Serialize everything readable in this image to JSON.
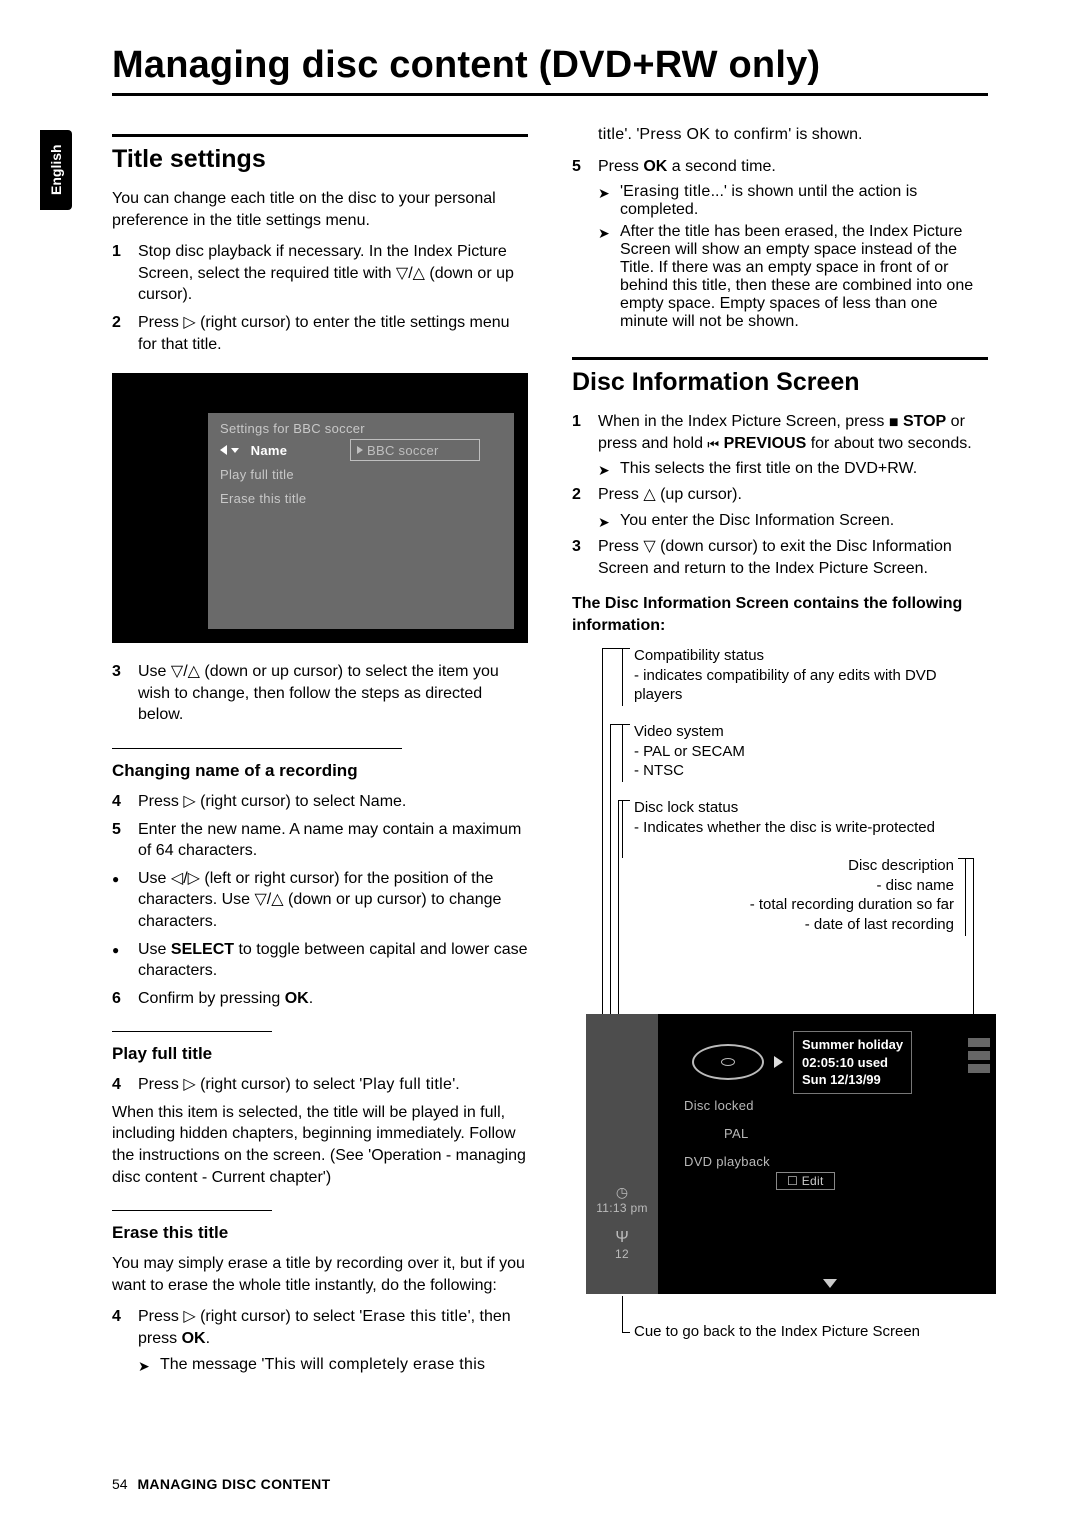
{
  "language_tab": "English",
  "page_title": "Managing disc content (DVD+RW only)",
  "footer": {
    "page_num": "54",
    "section": "MANAGING DISC CONTENT"
  },
  "left": {
    "section_title": "Title settings",
    "intro": "You can change each title on the disc to your personal preference in the title settings menu.",
    "step1": "Stop disc playback if necessary. In the Index Picture Screen, select the required title with ▽/△ (down or up cursor).",
    "step2": "Press ▷ (right cursor) to enter the title settings menu for that title.",
    "step3": "Use ▽/△ (down or up cursor) to select the item you wish to change, then follow the steps as directed below.",
    "shot": {
      "header": "Settings for BBC soccer",
      "row_name": "Name",
      "row_name_value": "BBC soccer",
      "row_play": "Play full title",
      "row_erase": "Erase this title"
    },
    "changing_name_title": "Changing name of a recording",
    "cn_step4": "Press ▷ (right cursor) to select Name.",
    "cn_step5": "Enter the new name. A name may contain a maximum of 64 characters.",
    "cn_bullet1": "Use ◁/▷ (left or right cursor) for the position of the characters. Use ▽/△ (down or up cursor) to change characters.",
    "cn_bullet2_a": "Use ",
    "cn_bullet2_b": "SELECT",
    "cn_bullet2_c": " to toggle between capital and lower case characters.",
    "cn_step6_a": "Confirm by pressing ",
    "cn_step6_b": "OK",
    "cn_step6_c": ".",
    "play_full_title": "Play full title",
    "pft_step4_a": "Press ▷ (right cursor) to select '",
    "pft_step4_b": "Play full title",
    "pft_step4_c": "'.",
    "pft_body": "When this item is selected, the title will be played in full, including hidden chapters, beginning immediately. Follow the instructions on the screen. (See 'Operation - managing disc content - Current chapter')",
    "erase_title": "Erase this title",
    "et_intro": "You may simply erase a title by recording over it, but if you want to erase the whole title instantly, do the following:",
    "et_step4_a": "Press ▷ (right cursor) to select '",
    "et_step4_b": "Erase this title",
    "et_step4_c": "', then press ",
    "et_step4_d": "OK",
    "et_step4_e": ".",
    "et_arrow1_a": "The message '",
    "et_arrow1_b": "This will completely erase this"
  },
  "right": {
    "cont_a": "title",
    "cont_b": "'. '",
    "cont_c": "Press OK to confirm",
    "cont_d": "' is shown.",
    "r_step5_a": "Press ",
    "r_step5_b": "OK",
    "r_step5_c": " a second time.",
    "r_arrow2_a": "'",
    "r_arrow2_b": "Erasing title",
    "r_arrow2_c": "...' is shown until the action is completed.",
    "r_arrow3": "After the title has been erased, the Index Picture Screen will show an empty space instead of the Title. If there was an empty space in front of or behind this title, then these are combined into one empty space. Empty spaces of less than one minute will not be shown.",
    "dis_title": "Disc Information Screen",
    "d_step1_a": "When in the Index Picture Screen, press ",
    "d_step1_stop": "STOP",
    "d_step1_b": " or press and hold ",
    "d_step1_prev": "PREVIOUS",
    "d_step1_c": " for about two seconds.",
    "d_arrow1": "This selects the first title on the DVD+RW.",
    "d_step2": "Press △ (up cursor).",
    "d_arrow2": "You enter the Disc Information Screen.",
    "d_step3": "Press ▽ (down cursor) to exit the Disc Information Screen and return to the Index Picture Screen.",
    "d_contains": "The Disc Information Screen contains the following information:",
    "callout1_a": "Compatibility status",
    "callout1_b": "- indicates compatibility of any edits with DVD players",
    "callout2_a": "Video system",
    "callout2_b": "- PAL or SECAM",
    "callout2_c": "- NTSC",
    "callout3_a": "Disc lock status",
    "callout3_b": "- Indicates whether the disc is write-protected",
    "callout4_a": "Disc description",
    "callout4_b": "- disc name",
    "callout4_c": "- total recording duration so far",
    "callout4_d": "- date of last recording",
    "callout5": "Cue to go back to the Index Picture Screen",
    "shot2": {
      "name": "Summer holiday",
      "used": "02:05:10 used",
      "date": "Sun 12/13/99",
      "disc_locked": "Disc locked",
      "pal": "PAL",
      "dvd_playback": "DVD playback",
      "edit": "Edit",
      "time": "11:13 pm",
      "ch": "12"
    }
  }
}
